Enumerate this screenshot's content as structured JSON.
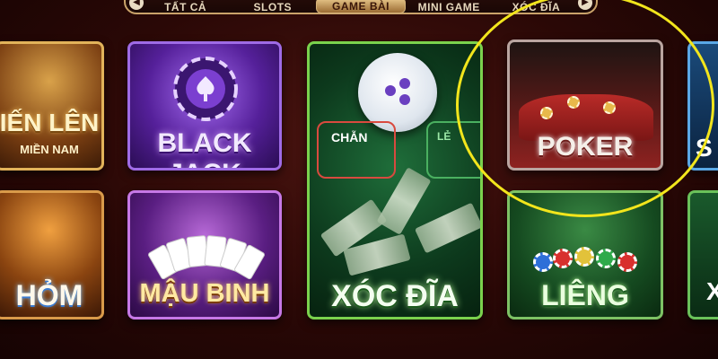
{
  "tabs": [
    {
      "label": "TẤT CẢ",
      "active": false
    },
    {
      "label": "SLOTS",
      "active": false
    },
    {
      "label": "GAME BÀI",
      "active": true
    },
    {
      "label": "MINI GAME",
      "active": false
    },
    {
      "label": "XÓC ĐĨA",
      "active": false
    }
  ],
  "nav": {
    "prev_icon": "◀",
    "next_icon": "▶"
  },
  "tiles": {
    "tienlen": {
      "title": "IẾN LÊN",
      "subtitle": "MIỀN NAM"
    },
    "blackjack": {
      "title": "BLACK JACK"
    },
    "xocdia": {
      "title": "XÓC ĐĨA",
      "chan": "CHẴN",
      "le": "LẺ"
    },
    "poker": {
      "title": "POKER"
    },
    "edge1": {
      "title": "S"
    },
    "xam": {
      "title": "HỎM"
    },
    "maubinh": {
      "title": "MẬU BINH"
    },
    "lieng": {
      "title": "LIÊNG"
    },
    "edge2": {
      "title": "X"
    }
  },
  "colors": {
    "highlight": "#f2e51c",
    "background": "#2a0806",
    "tab_active": "#e9c98c"
  }
}
